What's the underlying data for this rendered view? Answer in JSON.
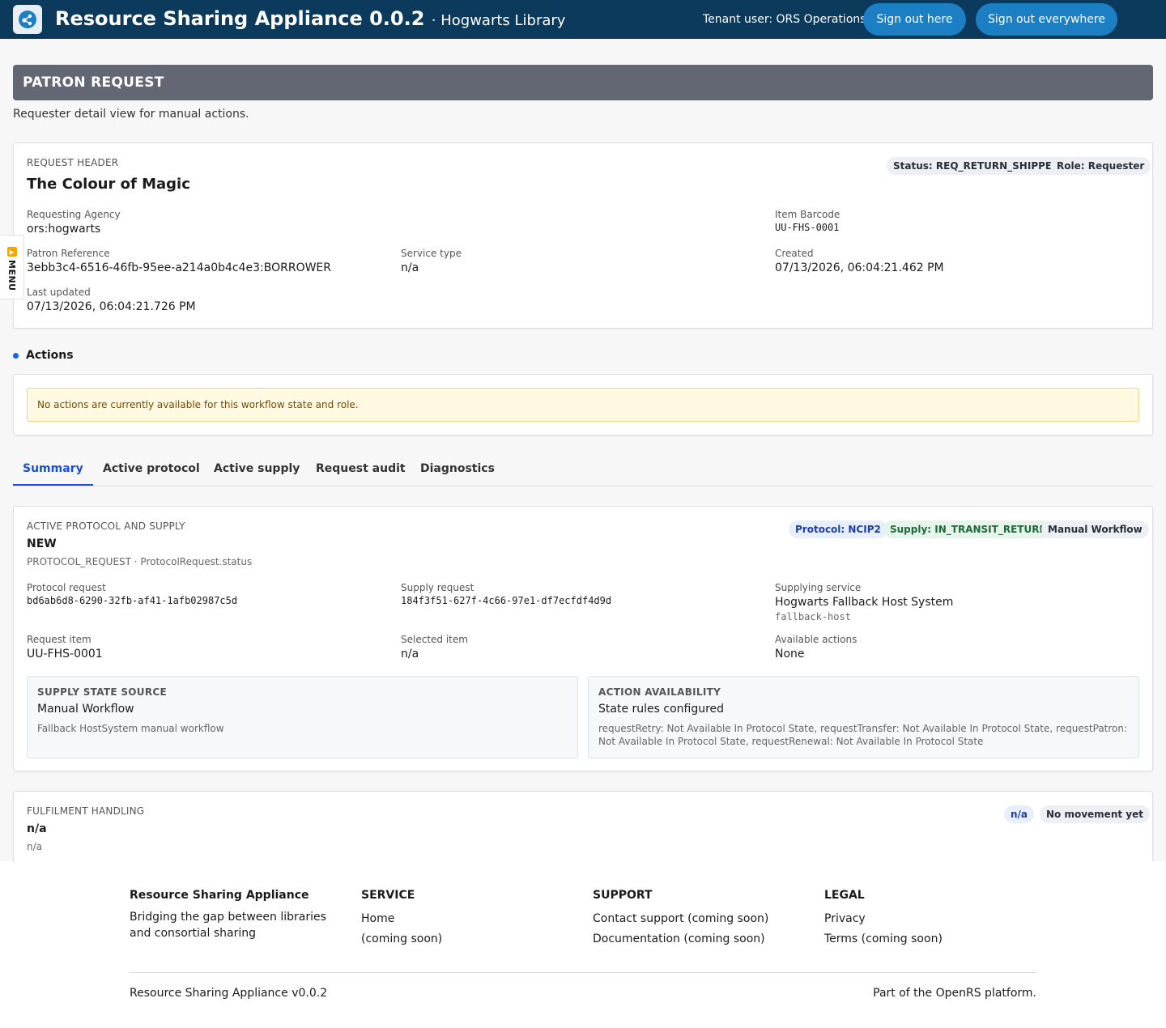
{
  "header": {
    "app_title": "Resource Sharing Appliance 0.0.2",
    "app_subtitle": "· Hogwarts Library",
    "tenant": "Tenant user: ORS Operations",
    "sign_out_here": "Sign out here",
    "sign_out_everywhere": "Sign out everywhere",
    "logo_icon": "share-nodes-icon"
  },
  "menu": {
    "label": "MENU",
    "icon": "play-icon"
  },
  "page": {
    "title": "PATRON REQUEST",
    "description": "Requester detail view for manual actions."
  },
  "request_header": {
    "eyebrow": "REQUEST HEADER",
    "title": "The Colour of Magic",
    "status_badge": "Status: REQ_RETURN_SHIPPED",
    "role_badge": "Role: Requester",
    "requesting_agency_label": "Requesting Agency",
    "requesting_agency": "ors:hogwarts",
    "item_barcode_label": "Item Barcode",
    "item_barcode": "UU-FHS-0001",
    "patron_reference_label": "Patron Reference",
    "patron_reference": "3ebb3c4-6516-46fb-95ee-a214a0b4c4e3:BORROWER",
    "service_type_label": "Service type",
    "service_type": "n/a",
    "created_label": "Created",
    "created": "07/13/2026, 06:04:21.462 PM",
    "last_updated_label": "Last updated",
    "last_updated": "07/13/2026, 06:04:21.726 PM"
  },
  "actions": {
    "heading": "Actions",
    "empty_message": "No actions are currently available for this workflow state and role."
  },
  "tabs": [
    {
      "label": "Summary",
      "active": true
    },
    {
      "label": "Active protocol",
      "active": false
    },
    {
      "label": "Active supply",
      "active": false
    },
    {
      "label": "Request audit",
      "active": false
    },
    {
      "label": "Diagnostics",
      "active": false
    }
  ],
  "protocol_supply": {
    "eyebrow": "ACTIVE PROTOCOL AND SUPPLY",
    "title": "NEW",
    "subtitle": "PROTOCOL_REQUEST · ProtocolRequest.status",
    "badge_protocol": "Protocol: NCIP2",
    "badge_supply": "Supply: IN_TRANSIT_RETURN",
    "badge_workflow": "Manual Workflow",
    "protocol_request_label": "Protocol request",
    "protocol_request": "bd6ab6d8-6290-32fb-af41-1afb02987c5d",
    "supply_request_label": "Supply request",
    "supply_request": "184f3f51-627f-4c66-97e1-df7ecfdf4d9d",
    "supplying_service_label": "Supplying service",
    "supplying_service": "Hogwarts Fallback Host System",
    "supplying_service_code": "fallback-host",
    "request_item_label": "Request item",
    "request_item": "UU-FHS-0001",
    "selected_item_label": "Selected item",
    "selected_item": "n/a",
    "available_actions_label": "Available actions",
    "available_actions": "None",
    "supply_state": {
      "heading": "SUPPLY STATE SOURCE",
      "title": "Manual Workflow",
      "detail": "Fallback HostSystem manual workflow"
    },
    "action_availability": {
      "heading": "ACTION AVAILABILITY",
      "title": "State rules configured",
      "detail": "requestRetry: Not Available In Protocol State, requestTransfer: Not Available In Protocol State, requestPatron: Not Available In Protocol State, requestRenewal: Not Available In Protocol State"
    }
  },
  "fulfilment": {
    "eyebrow": "FULFILMENT HANDLING",
    "title": "n/a",
    "subtitle": "n/a",
    "badge_na": "n/a",
    "badge_movement": "No movement yet"
  },
  "footer": {
    "brand": "Resource Sharing Appliance",
    "tagline": "Bridging the gap between libraries and consortial sharing",
    "service_head": "SERVICE",
    "service_links": [
      "Home",
      "(coming soon)"
    ],
    "support_head": "SUPPORT",
    "support_links": [
      "Contact support (coming soon)",
      "Documentation (coming soon)"
    ],
    "legal_head": "LEGAL",
    "legal_links": [
      "Privacy",
      "Terms (coming soon)"
    ],
    "version": "Resource Sharing Appliance v0.0.2",
    "platform": "Part of the OpenRS platform."
  }
}
